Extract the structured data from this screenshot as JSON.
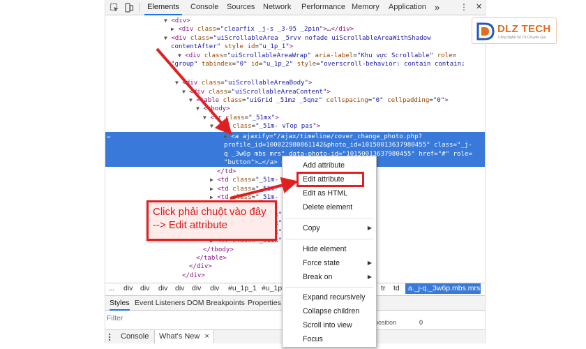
{
  "devtools": {
    "tabs": [
      {
        "label": "Elements"
      },
      {
        "label": "Console"
      },
      {
        "label": "Sources"
      },
      {
        "label": "Network"
      },
      {
        "label": "Performance"
      },
      {
        "label": "Memory"
      },
      {
        "label": "Application"
      }
    ],
    "more_tabs": "»",
    "menu_kebab": "⋮",
    "close": "✕"
  },
  "tree": [
    {
      "t": "▼",
      "parts": [
        [
          "tg",
          "<div>"
        ]
      ]
    },
    {
      "t": "▶",
      "parts": [
        [
          "tg",
          "<div "
        ],
        [
          "an",
          "class"
        ],
        [
          "tx",
          "="
        ],
        [
          "av",
          "\"clearfix _j-s _3-95 _2pin\""
        ],
        [
          "tg",
          ">"
        ],
        [
          "tx",
          "…"
        ],
        [
          "tg",
          "</div>"
        ]
      ]
    },
    {
      "t": "▼",
      "parts": [
        [
          "tg",
          "<div "
        ],
        [
          "an",
          "class"
        ],
        [
          "tx",
          "="
        ],
        [
          "av",
          "\"uiScrollableArea _5rvv nofade uiScrollableAreaWithShadow"
        ]
      ]
    },
    {
      "t": "",
      "parts": [
        [
          "av",
          "contentAfter\" "
        ],
        [
          "an",
          "style"
        ],
        [
          "tx",
          " "
        ],
        [
          "an",
          "id"
        ],
        [
          "tx",
          "="
        ],
        [
          "av",
          "\"u_1p_1\""
        ],
        [
          "tg",
          ">"
        ]
      ]
    },
    {
      "t": "▼",
      "parts": [
        [
          "tg",
          "<div "
        ],
        [
          "an",
          "class"
        ],
        [
          "tx",
          "="
        ],
        [
          "av",
          "\"uiScrollableAreaWrap\" "
        ],
        [
          "an",
          "aria-label"
        ],
        [
          "tx",
          "="
        ],
        [
          "av",
          "\"Khu vực Scrollable\" "
        ],
        [
          "an",
          "role"
        ],
        [
          "tx",
          "="
        ]
      ]
    },
    {
      "t": "",
      "parts": [
        [
          "av",
          "\"group\" "
        ],
        [
          "an",
          "tabindex"
        ],
        [
          "tx",
          "="
        ],
        [
          "av",
          "\"0\" "
        ],
        [
          "an",
          "id"
        ],
        [
          "tx",
          "="
        ],
        [
          "av",
          "\"u_1p_2\" "
        ],
        [
          "an",
          "style"
        ],
        [
          "tx",
          "="
        ],
        [
          "av",
          "\"overscroll-behavior: contain contain;"
        ]
      ]
    },
    {
      "t": "",
      "parts": [
        [
          "tx",
          ""
        ]
      ]
    },
    {
      "t": "▼",
      "parts": [
        [
          "tg",
          "<div "
        ],
        [
          "an",
          "class"
        ],
        [
          "tx",
          "="
        ],
        [
          "av",
          "\"uiScrollableAreaBody\""
        ],
        [
          "tg",
          ">"
        ]
      ]
    },
    {
      "t": "▼",
      "parts": [
        [
          "tg",
          "<div "
        ],
        [
          "an",
          "class"
        ],
        [
          "tx",
          "="
        ],
        [
          "av",
          "\"uiScrollableAreaContent\""
        ],
        [
          "tg",
          ">"
        ]
      ]
    },
    {
      "t": "▼",
      "parts": [
        [
          "tg",
          "<table "
        ],
        [
          "an",
          "class"
        ],
        [
          "tx",
          "="
        ],
        [
          "av",
          "\"uiGrid _51mz _5qnz\" "
        ],
        [
          "an",
          "cellspacing"
        ],
        [
          "tx",
          "="
        ],
        [
          "av",
          "\"0\" "
        ],
        [
          "an",
          "cellpadding"
        ],
        [
          "tx",
          "="
        ],
        [
          "av",
          "\"0\""
        ],
        [
          "tg",
          ">"
        ]
      ]
    },
    {
      "t": "▼",
      "parts": [
        [
          "tg",
          "<tbody>"
        ]
      ]
    },
    {
      "t": "▼",
      "parts": [
        [
          "tg",
          "<tr "
        ],
        [
          "an",
          "class"
        ],
        [
          "tx",
          "="
        ],
        [
          "av",
          "\"_51mx\""
        ],
        [
          "tg",
          ">"
        ]
      ]
    },
    {
      "t": "▼",
      "parts": [
        [
          "tg",
          "<td "
        ],
        [
          "an",
          "class"
        ],
        [
          "tx",
          "="
        ],
        [
          "av",
          "\"_51m- vTop pas\""
        ],
        [
          "tg",
          ">"
        ]
      ]
    }
  ],
  "tree_selected": [
    {
      "t": "▶",
      "parts": [
        [
          "tg",
          "<a "
        ],
        [
          "an",
          "ajaxify"
        ],
        [
          "tx",
          "="
        ],
        [
          "av",
          "\"/ajax/timeline/cover_change_photo.php?"
        ]
      ]
    },
    {
      "t": "",
      "parts": [
        [
          "av",
          "profile_id=100022980861142&photo_id=10150013637980455\" "
        ],
        [
          "an",
          "class"
        ],
        [
          "tx",
          "="
        ],
        [
          "av",
          "\"_j-"
        ]
      ]
    },
    {
      "t": "",
      "parts": [
        [
          "av",
          "q _3w6p mbs mrs\" "
        ],
        [
          "an",
          "data-photo-id"
        ],
        [
          "tx",
          "="
        ],
        [
          "av",
          "\"10150013637980455\" "
        ],
        [
          "an",
          "href"
        ],
        [
          "tx",
          "="
        ],
        [
          "av",
          "\"#\" "
        ],
        [
          "an",
          "role"
        ],
        [
          "tx",
          "="
        ]
      ]
    },
    {
      "t": "",
      "parts": [
        [
          "av",
          "\"button\""
        ],
        [
          "tg",
          ">"
        ],
        [
          "tx",
          "…"
        ],
        [
          "tg",
          "</a>"
        ],
        [
          "tx",
          " == $0"
        ]
      ]
    }
  ],
  "tree_after": [
    {
      "t": "",
      "parts": [
        [
          "tg",
          "</td>"
        ]
      ]
    },
    {
      "t": "▶",
      "parts": [
        [
          "tg",
          "<td "
        ],
        [
          "an",
          "class"
        ],
        [
          "tx",
          "="
        ],
        [
          "av",
          "\"_51m-"
        ]
      ]
    },
    {
      "t": "▶",
      "parts": [
        [
          "tg",
          "<td "
        ],
        [
          "an",
          "class"
        ],
        [
          "tx",
          "="
        ],
        [
          "av",
          "\"_51m-"
        ]
      ]
    },
    {
      "t": "▶",
      "parts": [
        [
          "tg",
          "<td "
        ],
        [
          "an",
          "class"
        ],
        [
          "tx",
          "="
        ],
        [
          "av",
          "\"_51m-"
        ]
      ]
    },
    {
      "t": "",
      "parts": [
        [
          "tg",
          "</tr>"
        ]
      ]
    },
    {
      "t": "▶",
      "parts": [
        [
          "tg",
          "<tr "
        ],
        [
          "an",
          "class"
        ],
        [
          "tx",
          "="
        ],
        [
          "av",
          "\"_51mx\""
        ],
        [
          "tg",
          ">"
        ],
        [
          "tx",
          "…"
        ],
        [
          "tg",
          "</tr>"
        ]
      ]
    },
    {
      "t": "▶",
      "parts": [
        [
          "tg",
          "<tr "
        ],
        [
          "an",
          "class"
        ],
        [
          "tx",
          "="
        ],
        [
          "av",
          "\"_51mx\""
        ],
        [
          "tg",
          ">"
        ],
        [
          "tx",
          "…"
        ],
        [
          "tg",
          "</tr>"
        ]
      ]
    },
    {
      "t": "▶",
      "parts": [
        [
          "tg",
          "<tr "
        ],
        [
          "an",
          "class"
        ],
        [
          "tx",
          "="
        ],
        [
          "av",
          "\"_51mx\""
        ],
        [
          "tg",
          ">"
        ],
        [
          "tx",
          "…"
        ],
        [
          "tg",
          "</tr>"
        ]
      ]
    },
    {
      "t": "▶",
      "parts": [
        [
          "tg",
          "<tr "
        ],
        [
          "an",
          "class"
        ],
        [
          "tx",
          "="
        ],
        [
          "av",
          "\"_51mx\""
        ],
        [
          "tg",
          ">"
        ],
        [
          "tx",
          "…"
        ],
        [
          "tg",
          "</tr>"
        ]
      ]
    },
    {
      "t": "",
      "parts": [
        [
          "tg",
          "</tbody>"
        ]
      ]
    },
    {
      "t": "",
      "parts": [
        [
          "tg",
          "</table>"
        ]
      ]
    },
    {
      "t": "",
      "parts": [
        [
          "tg",
          "</div>"
        ]
      ]
    },
    {
      "t": "",
      "parts": [
        [
          "tg",
          "</div>"
        ]
      ]
    }
  ],
  "selected_dots": "…",
  "breadcrumbs": [
    "...",
    "div",
    "div",
    "div",
    "div",
    "div",
    "div",
    "#u_1p_1",
    "#u_1p",
    "tr",
    "td"
  ],
  "breadcrumb_selected": "a._j-q._3w6p.mbs.mrs",
  "subtabs": [
    "Styles",
    "Event Listeners",
    "DOM Breakpoints",
    "Properties"
  ],
  "filter_placeholder": "Filter",
  "position_label": "position",
  "position_value": "0",
  "drawer_tabs": [
    "Console",
    "What's New"
  ],
  "drawer_close": "×",
  "context_menu": {
    "items": [
      {
        "label": "Add attribute"
      },
      {
        "label": "Edit attribute"
      },
      {
        "label": "Edit as HTML"
      },
      {
        "label": "Delete element"
      },
      {
        "label": "Copy",
        "submenu": true
      },
      {
        "label": "Hide element"
      },
      {
        "label": "Force state",
        "submenu": true
      },
      {
        "label": "Break on",
        "submenu": true
      },
      {
        "label": "Expand recursively"
      },
      {
        "label": "Collapse children"
      },
      {
        "label": "Scroll into view"
      },
      {
        "label": "Focus"
      }
    ]
  },
  "callout": {
    "line1": "Click phải chuột vào đây",
    "line2": "--> Edit attribute"
  },
  "logo": {
    "brand": "DLZ TECH",
    "tagline": "Công Nghệ Số Từ Chuyên Gia",
    "accent": "#e56d1f"
  },
  "colors": {
    "selection": "#3879d9",
    "annotation_red": "#e02020"
  }
}
